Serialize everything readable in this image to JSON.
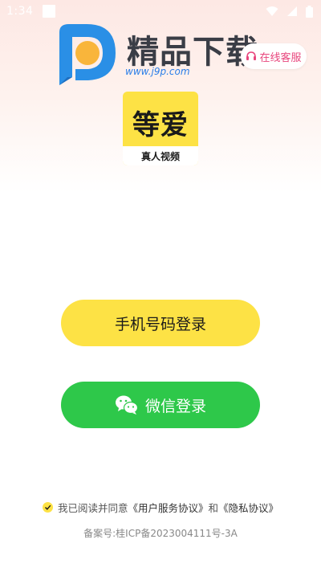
{
  "status_bar": {
    "time": "1:34",
    "icons": [
      "notification-square-icon",
      "wifi-icon",
      "signal-icon",
      "battery-icon"
    ]
  },
  "watermark": {
    "brand": "精品下载",
    "url": "www.j9p.com"
  },
  "header": {
    "customer_service_label": "在线客服",
    "accent_color": "#e8467d"
  },
  "app_logo": {
    "title": "等爱",
    "subtitle": "真人视频",
    "color": "#fde245"
  },
  "login": {
    "phone_label": "手机号码登录",
    "wechat_label": "微信登录",
    "phone_color": "#fde245",
    "wechat_color": "#2ec84a"
  },
  "agreement": {
    "prefix": "我已阅读并同意",
    "user_agreement": "《用户服务协议》",
    "conjunction": "和",
    "privacy_policy": "《隐私协议》",
    "checked": true
  },
  "footer": {
    "icp": "备案号:桂ICP备2023004111号-3A"
  }
}
